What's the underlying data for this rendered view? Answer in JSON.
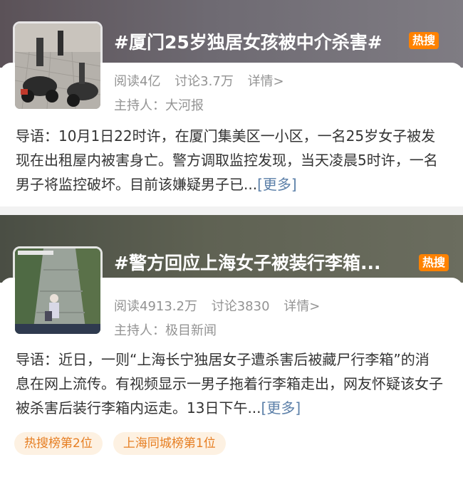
{
  "cards": [
    {
      "title": "#厦门25岁独居女孩被中介杀害#",
      "badge": "热搜",
      "reads": "阅读4亿",
      "discussions": "讨论3.7万",
      "details": "详情>",
      "host": "主持人：大河报",
      "intro": "导语：10月1日22时许，在厦门集美区一小区，一名25岁女子被发现在出租屋内被害身亡。警方调取监控发现，当天凌晨5时许，一名男子将监控破坏。目前该嫌疑男子已...",
      "more": "[更多]"
    },
    {
      "title": "#警方回应上海女子被装行李箱...",
      "badge": "热搜",
      "reads": "阅读4913.2万",
      "discussions": "讨论3830",
      "details": "详情>",
      "host": "主持人：极目新闻",
      "intro": "导语：近日，一则“上海长宁独居女子遭杀害后被藏尸行李箱”的消息在网上流传。有视频显示一男子拖着行李箱走出，网友怀疑该女子被杀害后装行李箱内运走。13日下午...",
      "more": "[更多]"
    }
  ],
  "tags": [
    "热搜榜第2位",
    "上海同城榜第1位"
  ],
  "colors": {
    "hot_badge": "#ff8200",
    "link": "#5b7fa8",
    "meta_text": "#939393",
    "tag_text": "#e67e22",
    "tag_bg": "#fdf1e2"
  }
}
